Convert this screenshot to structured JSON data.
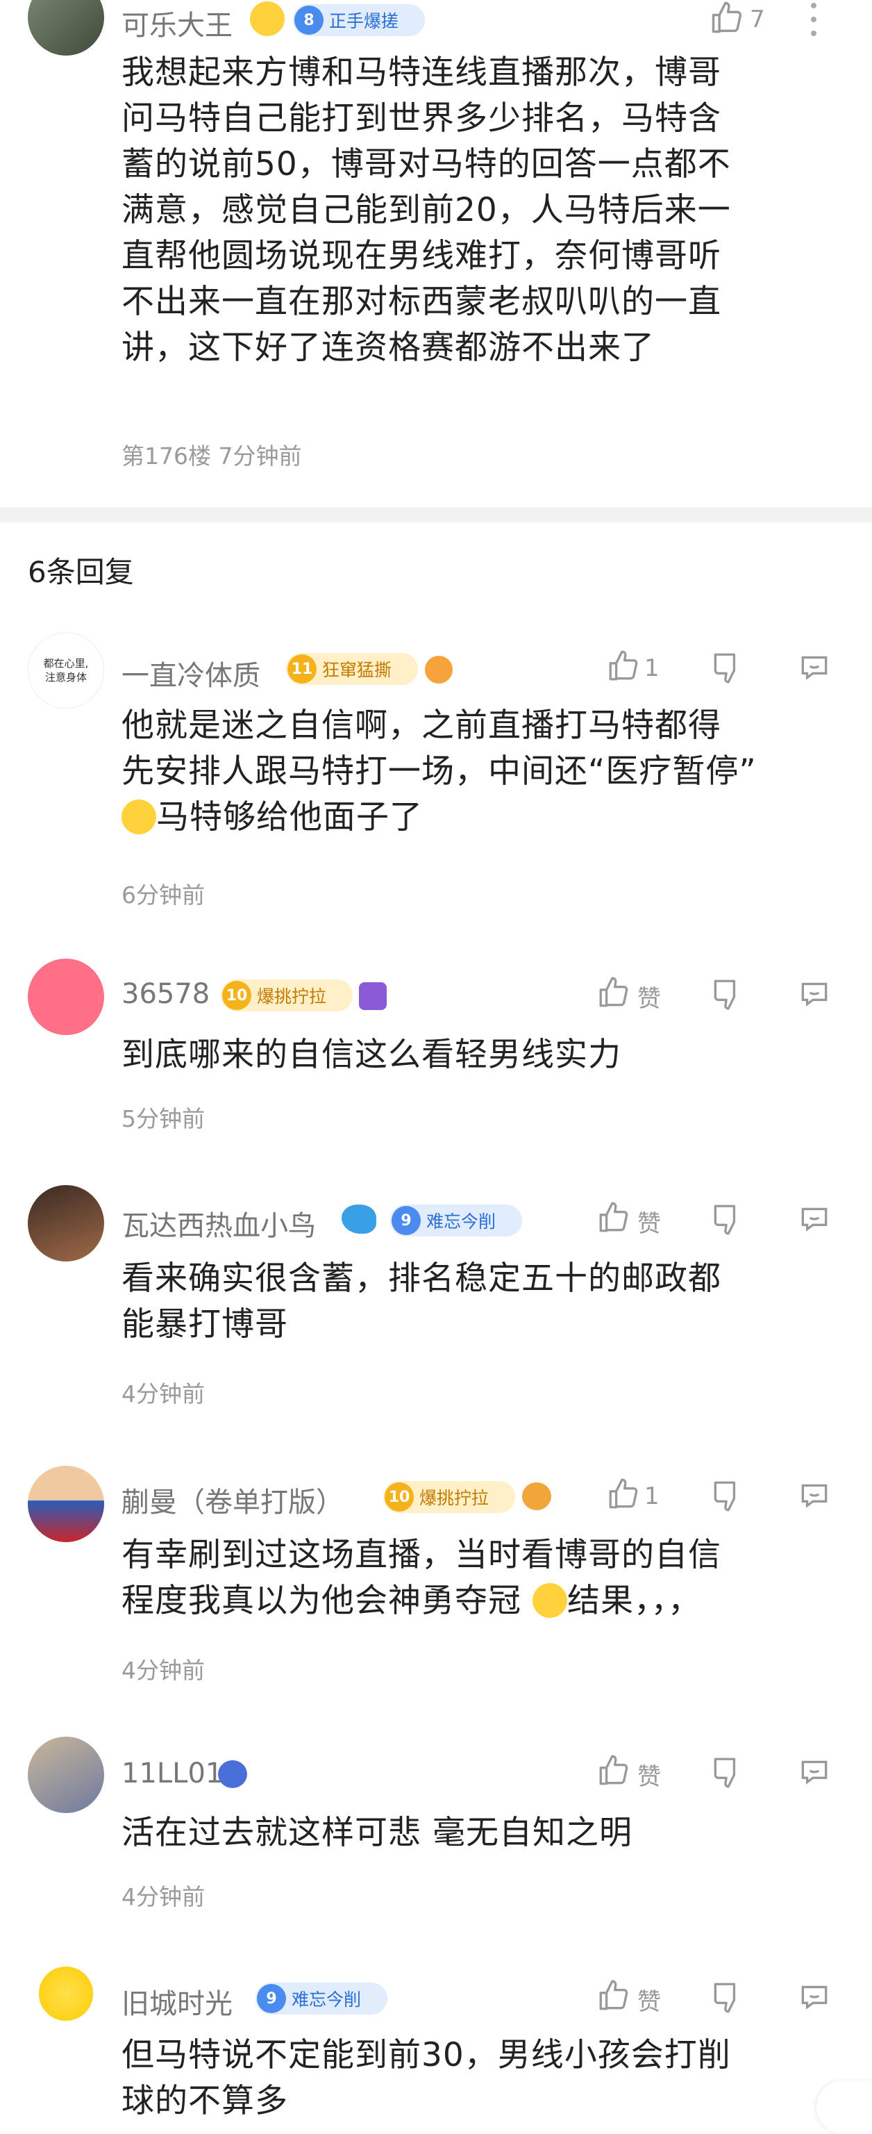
{
  "main": {
    "username": "可乐大王",
    "badge_level": "8",
    "badge_text": "正手爆搓",
    "like_count": "7",
    "body": [
      "我想起来方博和马特连线直播那次，博哥",
      "问马特自己能打到世界多少排名，马特含",
      "蓄的说前50，博哥对马特的回答一点都不",
      "满意，感觉自己能到前20，人马特后来一",
      "直帮他圆场说现在男线难打，奈何博哥听",
      "不出来一直在那对标西蒙老叔叭叭的一直",
      "讲，这下好了连资格赛都游不出来了"
    ],
    "meta": "第176楼 7分钟前"
  },
  "replies_header": "6条回复",
  "replies": [
    {
      "username": "一直冷体质",
      "badge_level": "11",
      "badge_text": "狂窜猛撕",
      "like": "1",
      "avatar_text": "都在心里,\n注意身体",
      "lines": [
        "他就是迷之自信啊，之前直播打马特都得",
        "先安排人跟马特打一场，中间还“医疗暂停”",
        "马特够给他面子了"
      ],
      "time": "6分钟前"
    },
    {
      "username": "36578",
      "badge_level": "10",
      "badge_text": "爆挑拧拉",
      "like": "赞",
      "lines": [
        "到底哪来的自信这么看轻男线实力"
      ],
      "time": "5分钟前"
    },
    {
      "username": "瓦达西热血小鸟",
      "badge_level": "9",
      "badge_text": "难忘今削",
      "like": "赞",
      "lines": [
        "看来确实很含蓄，排名稳定五十的邮政都",
        "能暴打博哥"
      ],
      "time": "4分钟前"
    },
    {
      "username": "蒯曼（卷单打版）",
      "badge_level": "10",
      "badge_text": "爆挑拧拉",
      "like": "1",
      "lines": [
        "有幸刷到过这场直播，当时看博哥的自信",
        "程度我真以为他会神勇夺冠",
        "结果，，，"
      ],
      "time": "4分钟前"
    },
    {
      "username": "11LL01",
      "like": "赞",
      "lines": [
        "活在过去就这样可悲 毫无自知之明"
      ],
      "time": "4分钟前"
    },
    {
      "username": "旧城时光",
      "badge_level": "9",
      "badge_text": "难忘今削",
      "like": "赞",
      "lines": [
        "但马特说不定能到前30，男线小孩会打削",
        "球的不算多"
      ]
    }
  ],
  "colors": {
    "blue_badge": "#4a8bf0",
    "gold_badge": "#f6b21a",
    "meta_gray": "#9a9a9a"
  }
}
